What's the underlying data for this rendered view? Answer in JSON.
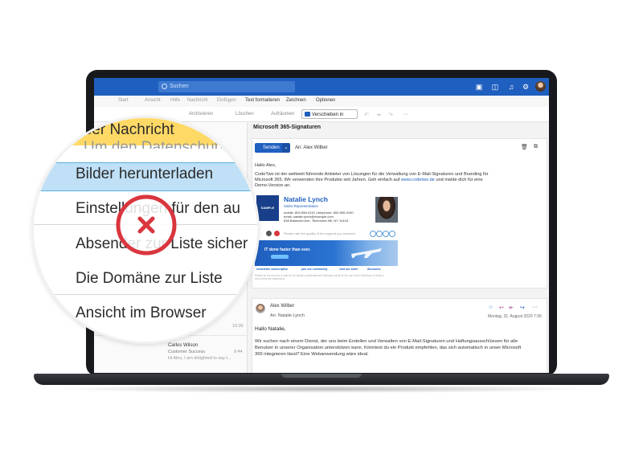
{
  "app": {
    "search_placeholder": "Suchen",
    "menu": [
      "Start",
      "Ansicht",
      "Hilfe",
      "Nachricht",
      "Einfügen",
      "Text formatieren",
      "Zeichnen",
      "Optionen"
    ],
    "ribbon": {
      "archive_label": "Archivieren",
      "delete_label": "Löschen",
      "respond_label": "Aufräumen",
      "move_label": "Verschieben in",
      "more": "···"
    }
  },
  "message_list": {
    "items": [
      {
        "time": "10:36"
      },
      {
        "name": "Carlos Wilson",
        "subject": "Customer Success",
        "preview": "Hi Alex, I am delighted to say t...",
        "time": "9:44"
      }
    ]
  },
  "reading": {
    "subject": "Microsoft 365-Signaturen",
    "compose": {
      "send_label": "Senden",
      "to_line": "An: Alex Wilber",
      "greeting": "Hallo Alex,",
      "body_1": "CodeTwo ist der weltweit führende Anbieter von Lösungen für die Verwaltung von E-Mail-Signaturen und Branding für",
      "body_2": "Microsoft 365. Wir verwenden ihre Produkte seit Jahren. Geh einfach auf",
      "link": "www.codetwo.de",
      "body_3": "und melde dich für eine",
      "body_4": "Demo-Version an."
    },
    "signature": {
      "name": "Natalie Lynch",
      "role": "Sales Representative",
      "mobile": "mobile: 800-556-0115  |  telephone: 800-555-0150",
      "email": "email: natalie.lynch@example.com",
      "address": "638 Balanced Ave., Richmond Hill, NY 11418",
      "rate_text": "Please rate the quality of the support you received",
      "banner_title": "IT done faster than ever.",
      "banner_links": [
        "newsletter subscription",
        "join our community",
        "visit our store",
        "discounts"
      ],
      "disclaimer": "Please do not use this e-mail as it is strictly confidential and intended solely for the use of the individual or entity to whom they are addressed."
    },
    "reply": {
      "from": "Alex Wilber",
      "to": "An: Natalie Lynch",
      "date": "Montag, 31. August 2020 7:36",
      "greeting": "Hallo Natalie,",
      "body": "Wir suchen nach einem Dienst, der uns beim Erstellen und Verwalten von E-Mail-Signaturen und Haftungsausschlüssen für alle Benutzer in unserer Organisation unterstützen kann. Könntest du ein Produkt empfehlen, das sich automatisch in unser Microsoft 365 integrieren lässt? Eine Webanwendung wäre ideal."
    }
  },
  "magnifier": {
    "row_yellow": "ieser Nachricht",
    "row_cut": "Um den Datenschutz",
    "row_download": "Bilder herunterladen",
    "row_settings": "Einstellungen für den au",
    "row_sender": "Absender zur Liste sicher",
    "row_domain": "Die Domäne zur Liste",
    "row_browser": "Ansicht im Browser",
    "x_color": "#d9363e",
    "highlight_color": "#bfe0f7"
  }
}
